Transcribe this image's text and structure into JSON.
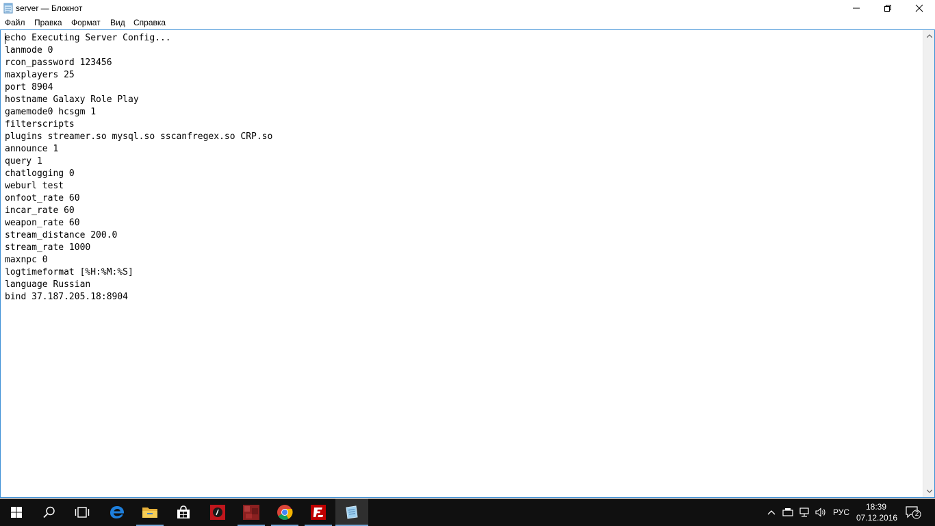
{
  "window": {
    "title": "server — Блокнот",
    "icon": "notepad-icon"
  },
  "menu": {
    "items": [
      "Файл",
      "Правка",
      "Формат",
      "Вид",
      "Справка"
    ]
  },
  "editor": {
    "lines": [
      "echo Executing Server Config...",
      "lanmode 0",
      "rcon_password 123456",
      "maxplayers 25",
      "port 8904",
      "hostname Galaxy Role Play",
      "gamemode0 hcsgm 1",
      "filterscripts",
      "plugins streamer.so mysql.so sscanfregex.so CRP.so",
      "announce 1",
      "query 1",
      "chatlogging 0",
      "weburl test",
      "onfoot_rate 60",
      "incar_rate 60",
      "weapon_rate 60",
      "stream_distance 200.0",
      "stream_rate 1000",
      "maxnpc 0",
      "logtimeformat [%H:%M:%S]",
      "language Russian",
      "bind 37.187.205.18:8904"
    ]
  },
  "taskbar": {
    "apps": [
      "start-icon",
      "search-icon",
      "task-view-icon",
      "edge-icon",
      "file-explorer-icon",
      "store-icon",
      "app-red-icon",
      "app-dark-red-icon",
      "chrome-icon",
      "filezilla-icon",
      "notepad-icon"
    ],
    "language": "РУС",
    "time": "18:39",
    "date": "07.12.2016",
    "notifications": "2"
  },
  "colors": {
    "taskbar_bg": "#101010",
    "editor_border": "#3c8fd6"
  }
}
